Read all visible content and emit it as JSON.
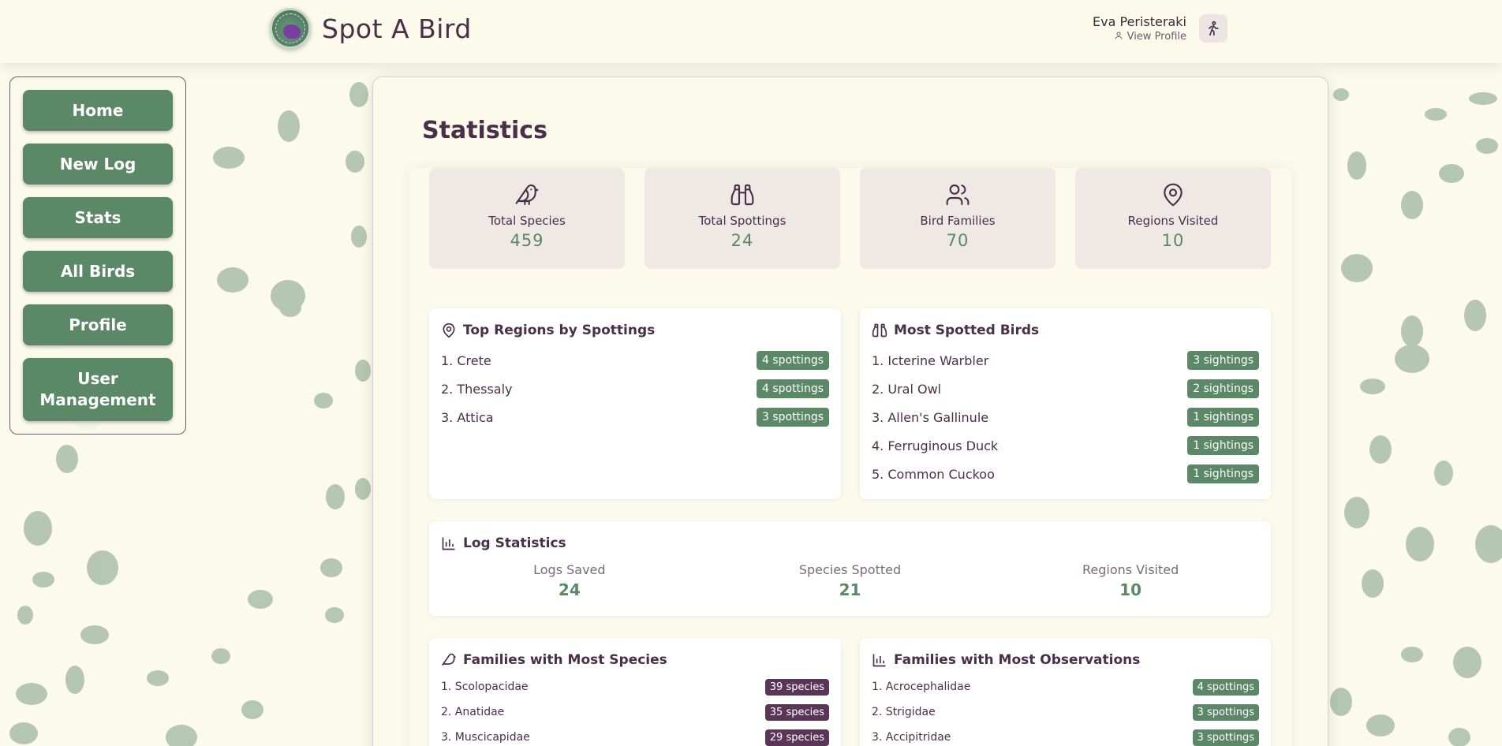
{
  "app": {
    "title": "Spot A Bird",
    "logo_text": "Spot A Bird"
  },
  "user": {
    "name": "Eva Peristeraki",
    "view_profile": "View Profile",
    "icon": "hiker-icon"
  },
  "sidebar": {
    "items": [
      {
        "label": "Home"
      },
      {
        "label": "New Log"
      },
      {
        "label": "Stats"
      },
      {
        "label": "All Birds"
      },
      {
        "label": "Profile"
      },
      {
        "label": "User Management"
      }
    ]
  },
  "page": {
    "title": "Statistics"
  },
  "stats": [
    {
      "label": "Total Species",
      "value": "459",
      "icon": "bird-icon"
    },
    {
      "label": "Total Spottings",
      "value": "24",
      "icon": "binoculars-icon"
    },
    {
      "label": "Bird Families",
      "value": "70",
      "icon": "users-icon"
    },
    {
      "label": "Regions Visited",
      "value": "10",
      "icon": "map-pin-icon"
    }
  ],
  "top_regions": {
    "title": "Top Regions by Spottings",
    "rows": [
      {
        "name": "1. Crete",
        "badge": "4 spottings"
      },
      {
        "name": "2. Thessaly",
        "badge": "4 spottings"
      },
      {
        "name": "3. Attica",
        "badge": "3 spottings"
      }
    ]
  },
  "most_spotted": {
    "title": "Most Spotted Birds",
    "rows": [
      {
        "name": "1. Icterine Warbler",
        "badge": "3 sightings"
      },
      {
        "name": "2. Ural Owl",
        "badge": "2 sightings"
      },
      {
        "name": "3. Allen's Gallinule",
        "badge": "1 sightings"
      },
      {
        "name": "4. Ferruginous Duck",
        "badge": "1 sightings"
      },
      {
        "name": "5. Common Cuckoo",
        "badge": "1 sightings"
      }
    ]
  },
  "log_stats": {
    "title": "Log Statistics",
    "items": [
      {
        "label": "Logs Saved",
        "value": "24"
      },
      {
        "label": "Species Spotted",
        "value": "21"
      },
      {
        "label": "Regions Visited",
        "value": "10"
      }
    ]
  },
  "families_species": {
    "title": "Families with Most Species",
    "rows": [
      {
        "name": "1. Scolopacidae",
        "badge": "39 species"
      },
      {
        "name": "2. Anatidae",
        "badge": "35 species"
      },
      {
        "name": "3. Muscicapidae",
        "badge": "29 species"
      }
    ]
  },
  "families_observations": {
    "title": "Families with Most Observations",
    "rows": [
      {
        "name": "1. Acrocephalidae",
        "badge": "4 spottings"
      },
      {
        "name": "2. Strigidae",
        "badge": "3 spottings"
      },
      {
        "name": "3. Accipitridae",
        "badge": "3 spottings"
      }
    ]
  },
  "colors": {
    "primary_green": "#5b8866",
    "accent_purple": "#5b3558",
    "background": "#fbfaeb",
    "text": "#4a2f49"
  }
}
